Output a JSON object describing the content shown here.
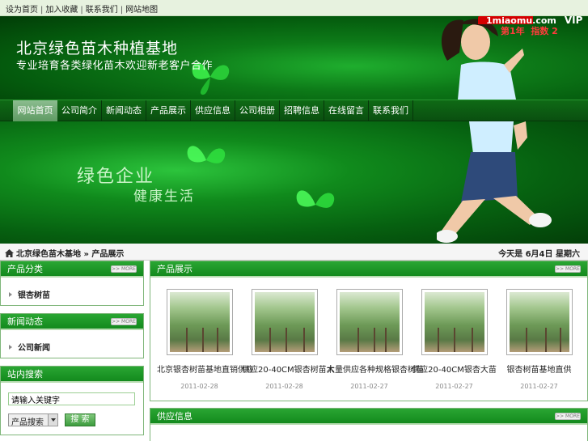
{
  "top_links": [
    "设为首页",
    "加入收藏",
    "联系我们",
    "网站地图"
  ],
  "header": {
    "site_name": "北京绿色苗木种植基地",
    "slogan": "专业培育各类绿化苗木欢迎新老客户合作",
    "vip": {
      "domain": "1miaomu.com",
      "vip_label": "VIP",
      "year_label": "第1年",
      "index_label": "指数",
      "index_value": "2"
    }
  },
  "nav": [
    "网站首页",
    "公司简介",
    "新闻动态",
    "产品展示",
    "供应信息",
    "公司相册",
    "招聘信息",
    "在线留言",
    "联系我们"
  ],
  "hero": {
    "line1": "绿色企业",
    "line2": "健康生活"
  },
  "breadcrumb": {
    "text": "北京绿色苗木基地 » 产品展示",
    "date": "今天是 6月4日 星期六"
  },
  "sidebar": {
    "categories": {
      "title": "产品分类",
      "more": ">> MORE",
      "items": [
        "银杏树苗"
      ]
    },
    "news": {
      "title": "新闻动态",
      "more": ">> MORE",
      "items": [
        "公司新闻"
      ]
    },
    "search": {
      "title": "站内搜索",
      "value": "请输入关键字",
      "select": "产品搜索",
      "button": "搜 索"
    }
  },
  "products_panel": {
    "title": "产品展示",
    "more": ">> MORE",
    "items": [
      {
        "name": "北京银杏树苗基地直销供应",
        "date": "2011-02-28"
      },
      {
        "name": "供应20-40CM银杏树苗木",
        "date": "2011-02-28"
      },
      {
        "name": "大量供应各种规格银杏树苗",
        "date": "2011-02-27"
      },
      {
        "name": "供应20-40CM银杏大苗",
        "date": "2011-02-27"
      },
      {
        "name": "银杏树苗基地直供",
        "date": "2011-02-27"
      }
    ]
  },
  "supply_panel": {
    "title": "供应信息",
    "more": ">> MORE"
  },
  "colors": {
    "brand_green": "#138a1d",
    "nav_dark": "#0a4f10",
    "top_bar": "#e7f2df"
  }
}
